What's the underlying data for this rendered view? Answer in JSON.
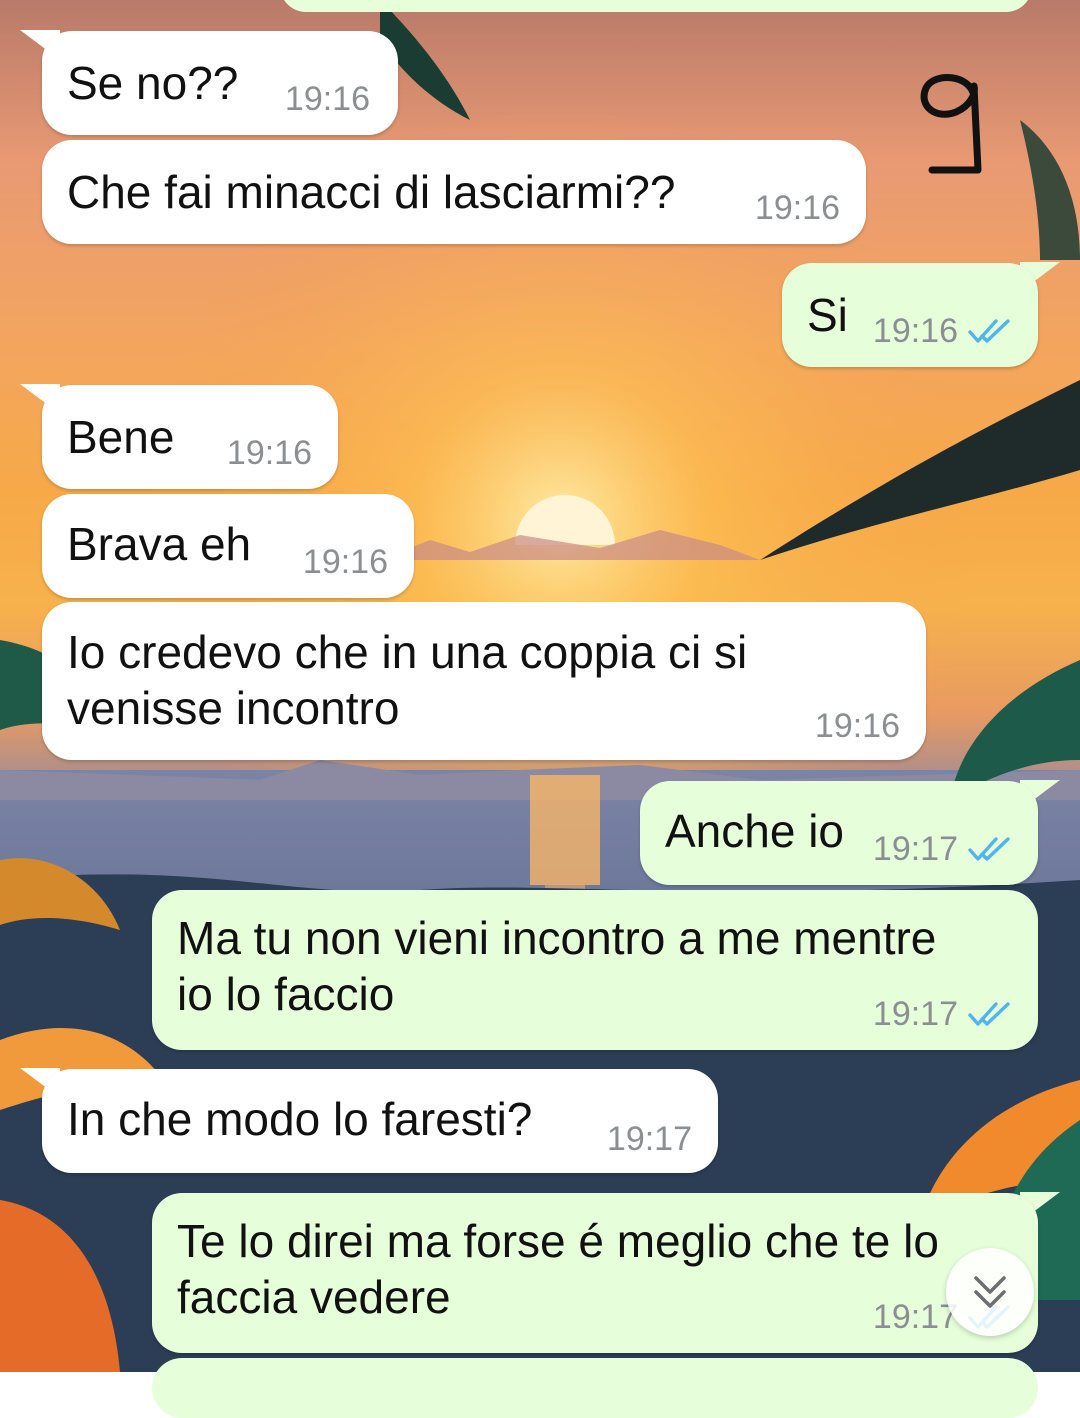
{
  "chat": {
    "messages": [
      {
        "id": "m1",
        "direction": "in",
        "text": "Se no??",
        "time": "19:16"
      },
      {
        "id": "m2",
        "direction": "in",
        "text": "Che fai minacci di lasciarmi??",
        "time": "19:16"
      },
      {
        "id": "m3",
        "direction": "out",
        "text": "Si",
        "time": "19:16",
        "status": "read"
      },
      {
        "id": "m4",
        "direction": "in",
        "text": "Bene",
        "time": "19:16"
      },
      {
        "id": "m5",
        "direction": "in",
        "text": "Brava eh",
        "time": "19:16"
      },
      {
        "id": "m6",
        "direction": "in",
        "text": "Io credevo che in una coppia ci si\nvenisse incontro",
        "time": "19:16"
      },
      {
        "id": "m7",
        "direction": "out",
        "text": "Anche io",
        "time": "19:17",
        "status": "read"
      },
      {
        "id": "m8",
        "direction": "out",
        "text": "Ma tu non vieni incontro a me mentre\nio lo faccio",
        "time": "19:17",
        "status": "read"
      },
      {
        "id": "m9",
        "direction": "in",
        "text": "In che modo lo faresti?",
        "time": "19:17"
      },
      {
        "id": "m10",
        "direction": "out",
        "text": "Te lo direi ma forse é meglio che te lo\nfaccia vedere",
        "time": "19:17",
        "status": "read"
      }
    ]
  },
  "annotation": {
    "page_number": "9"
  },
  "icons": {
    "read_receipt": "double-check-icon",
    "scroll_down": "chevron-double-down-icon"
  },
  "colors": {
    "incoming_bubble": "#ffffff",
    "outgoing_bubble": "#e6ffda",
    "timestamp": "#8c8f91",
    "read_tick": "#4fb6ec"
  }
}
